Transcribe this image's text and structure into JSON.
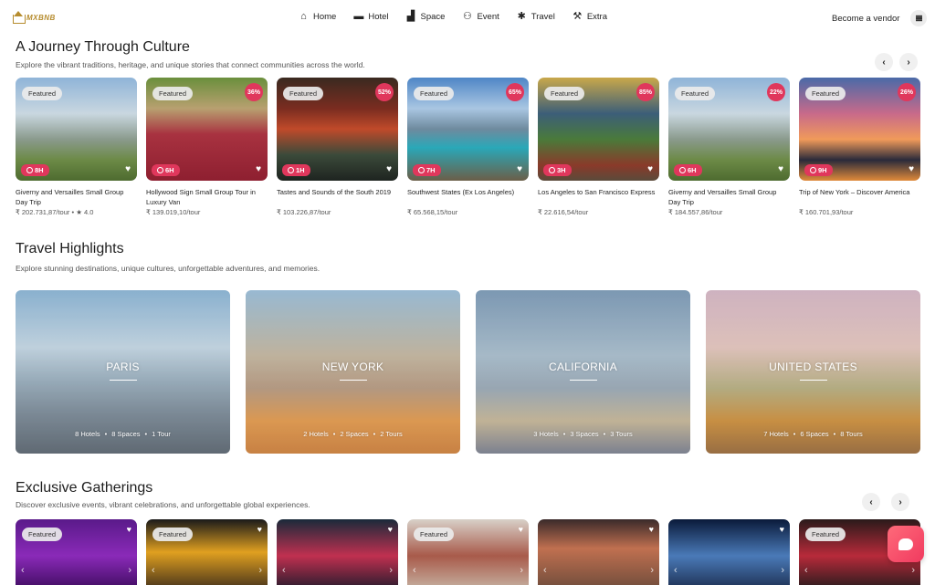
{
  "header": {
    "logo": "MXBNB",
    "nav": [
      {
        "label": "Home",
        "icon": "house-icon",
        "glyph": "⌂"
      },
      {
        "label": "Hotel",
        "icon": "bed-icon",
        "glyph": "▬"
      },
      {
        "label": "Space",
        "icon": "sofa-icon",
        "glyph": "▟"
      },
      {
        "label": "Event",
        "icon": "people-icon",
        "glyph": "⚇"
      },
      {
        "label": "Travel",
        "icon": "palm-tree-icon",
        "glyph": "✱"
      },
      {
        "label": "Extra",
        "icon": "tools-icon",
        "glyph": "⚒"
      }
    ],
    "vendor_label": "Become a vendor"
  },
  "culture": {
    "title": "A Journey Through Culture",
    "subtitle": "Explore the vibrant traditions, heritage, and unique stories that connect communities across the world.",
    "prev": "‹",
    "next": "›",
    "cards": [
      {
        "featured": "Featured",
        "discount": "",
        "duration": "8H",
        "title": "Giverny and Versailles Small Group Day Trip",
        "price": "₹ 202.731,87/tour  •  ★ 4.0",
        "bg": "linear-gradient(180deg,#8fb4d8 0%,#c9d7e0 35%,#8a9a8c 60%,#6c8a46 80%,#4e6b30 100%)"
      },
      {
        "featured": "Featured",
        "discount": "36%",
        "duration": "6H",
        "title": "Hollywood Sign Small Group Tour in Luxury Van",
        "price": "₹ 139.019,10/tour",
        "bg": "linear-gradient(180deg,#6a8f3c 0%,#b8a070 30%,#a83240 55%,#8e1f30 100%)"
      },
      {
        "featured": "Featured",
        "discount": "52%",
        "duration": "1H",
        "title": "Tastes and Sounds of the South 2019",
        "price": "₹ 103.226,87/tour",
        "bg": "linear-gradient(180deg,#3a2a20 0%,#7a2c20 30%,#c04a2a 50%,#3b4a3a 75%,#1e2420 100%)"
      },
      {
        "featured": "Featured",
        "discount": "65%",
        "duration": "7H",
        "title": "Southwest States (Ex Los Angeles)",
        "price": "₹ 65.568,15/tour",
        "bg": "linear-gradient(180deg,#4f86c6 0%,#a9c6e2 30%,#6e8a9e 50%,#2aa8b8 68%,#6b5e48 100%)"
      },
      {
        "featured": "Featured",
        "discount": "85%",
        "duration": "3H",
        "title": "Los Angeles to San Francisco Express",
        "price": "₹ 22.616,54/tour",
        "bg": "linear-gradient(180deg,#c9a84a 0%,#3c5e78 35%,#4a7a3a 60%,#8a3a2a 85%,#5a4a3a 100%)"
      },
      {
        "featured": "Featured",
        "discount": "22%",
        "duration": "6H",
        "title": "Giverny and Versailles Small Group Day Trip",
        "price": "₹ 184.557,86/tour",
        "bg": "linear-gradient(180deg,#8fb4d8 0%,#c9d7e0 35%,#8a9a8c 60%,#6c8a46 80%,#4e6b30 100%)"
      },
      {
        "featured": "Featured",
        "discount": "26%",
        "duration": "9H",
        "title": "Trip of New York – Discover America",
        "price": "₹ 160.701,93/tour",
        "bg": "linear-gradient(180deg,#4a6aa8 0%,#c86a8a 35%,#f09a5a 60%,#2a2a3a 80%,#e08a3a 100%)"
      }
    ]
  },
  "highlights": {
    "title": "Travel Highlights",
    "subtitle": "Explore stunning destinations, unique cultures, unforgettable adventures, and memories.",
    "cards": [
      {
        "name": "PARIS",
        "hotels": "8 Hotels",
        "spaces": "8 Spaces",
        "tours": "1 Tour",
        "bg": "linear-gradient(180deg,#7aa6c8 0%,#b6cad8 35%,#8aa0b0 55%,#6a7a88 75%,#4a5560 100%)"
      },
      {
        "name": "NEW YORK",
        "hotels": "2 Hotels",
        "spaces": "2 Spaces",
        "tours": "2 Tours",
        "bg": "linear-gradient(180deg,#8ab0cc 0%,#b6a890 40%,#a88a70 60%,#d68a3a 80%,#c0702a 100%)"
      },
      {
        "name": "CALIFORNIA",
        "hotels": "3 Hotels",
        "spaces": "3 Spaces",
        "tours": "3 Tours",
        "bg": "linear-gradient(180deg,#6a8aa8 0%,#9ab0c0 40%,#8a9aa8 60%,#b8a888 80%,#6a7080 100%)"
      },
      {
        "name": "UNITED STATES",
        "hotels": "7 Hotels",
        "spaces": "6 Spaces",
        "tours": "8 Tours",
        "bg": "linear-gradient(180deg,#c8a8b8 0%,#d8b8b0 35%,#a8a070 60%,#c0802a 80%,#8a5a2a 100%)"
      }
    ]
  },
  "gatherings": {
    "title": "Exclusive Gatherings",
    "subtitle": "Discover exclusive events, vibrant celebrations, and unforgettable global experiences.",
    "prev": "‹",
    "next": "›",
    "cards": [
      {
        "featured": "Featured",
        "bg": "linear-gradient(180deg,#5a1a8a 0%,#8a2ab8 50%,#3a0a5a 100%)"
      },
      {
        "featured": "Featured",
        "bg": "linear-gradient(180deg,#1a1a1a 0%,#e0a020 45%,#3a2a1a 100%)"
      },
      {
        "featured": "",
        "bg": "linear-gradient(180deg,#1a2a3a 0%,#c03050 50%,#1a1a2a 100%)"
      },
      {
        "featured": "Featured",
        "bg": "linear-gradient(180deg,#d8d0c8 0%,#a85a4a 50%,#c8b8a8 100%)"
      },
      {
        "featured": "",
        "bg": "linear-gradient(180deg,#3a2a2a 0%,#c07050 40%,#6a4a3a 100%)"
      },
      {
        "featured": "",
        "bg": "linear-gradient(180deg,#0a1a3a 0%,#4a7ab8 50%,#1a2a4a 100%)"
      },
      {
        "featured": "Featured",
        "bg": "linear-gradient(180deg,#2a1a1a 0%,#b82a3a 50%,#1a1a1a 100%)"
      }
    ]
  },
  "colors": {
    "accent": "#e0375c",
    "logo": "#b68c2e"
  }
}
